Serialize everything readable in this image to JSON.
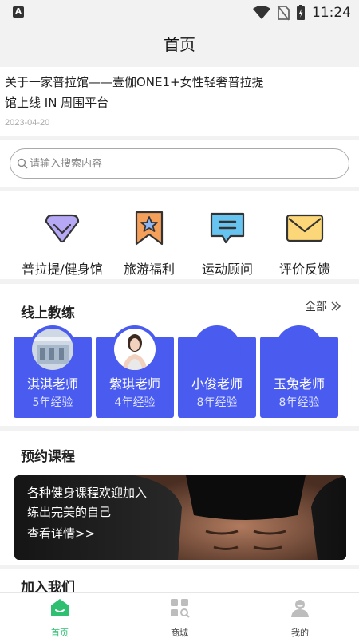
{
  "status_bar": {
    "app_badge": "A",
    "time": "11:24"
  },
  "page_title": "首页",
  "news": {
    "title": "关于一家普拉馆——壹伽ONE1+女性轻奢普拉提馆上线 IN 周围平台",
    "date": "2023-04-20"
  },
  "search": {
    "placeholder": "请输入搜索内容",
    "value": ""
  },
  "categories": [
    {
      "label": "普拉提/健身馆",
      "icon": "diamond-icon"
    },
    {
      "label": "旅游福利",
      "icon": "star-ribbon-icon"
    },
    {
      "label": "运动顾问",
      "icon": "chat-bubble-icon"
    },
    {
      "label": "评价反馈",
      "icon": "envelope-icon"
    }
  ],
  "coaches_section": {
    "title": "线上教练",
    "more_label": "全部",
    "coaches": [
      {
        "name": "淇淇老师",
        "experience": "5年经验"
      },
      {
        "name": "紫琪老师",
        "experience": "4年经验"
      },
      {
        "name": "小俊老师",
        "experience": "8年经验"
      },
      {
        "name": "玉兔老师",
        "experience": "8年经验"
      }
    ]
  },
  "course_section": {
    "title": "预约课程",
    "banner_line1": "各种健身课程欢迎加入",
    "banner_line2": "练出完美的自己",
    "banner_link": "查看详情>>"
  },
  "join_section": {
    "title": "加入我们"
  },
  "tabbar": {
    "items": [
      {
        "label": "首页",
        "icon": "home-icon",
        "active": true
      },
      {
        "label": "商城",
        "icon": "grid-icon",
        "active": false
      },
      {
        "label": "我的",
        "icon": "profile-icon",
        "active": false
      }
    ]
  },
  "colors": {
    "accent": "#4a5bf0",
    "tab_active": "#2fbf71",
    "icon_orange": "#f5a05a",
    "icon_blue": "#67c3f0",
    "icon_purple": "#8f7fe0"
  }
}
